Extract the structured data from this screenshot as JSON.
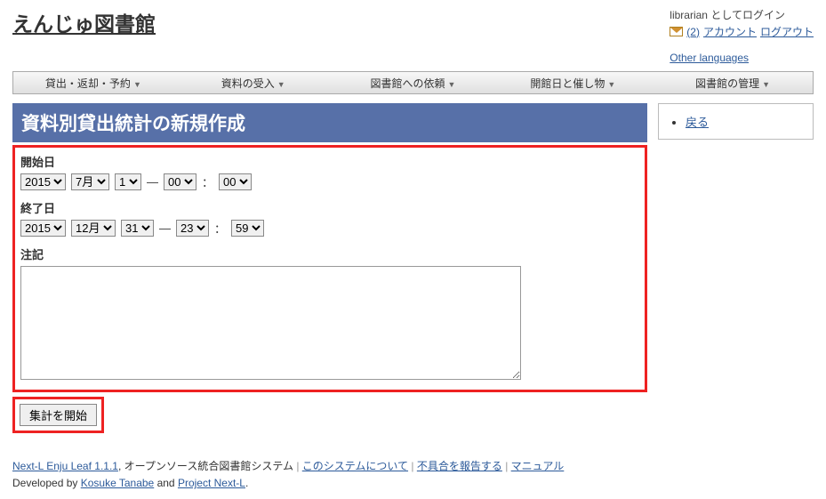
{
  "site_title": "えんじゅ図書館",
  "login_status": "librarian としてログイン",
  "login_links": {
    "count": "(2)",
    "account": "アカウント",
    "logout": "ログアウト"
  },
  "other_languages": "Other languages",
  "menu": {
    "loan": "貸出・返却・予約",
    "receive": "資料の受入",
    "request": "図書館への依頼",
    "holiday": "開館日と催し物",
    "admin": "図書館の管理"
  },
  "page_title": "資料別貸出統計の新規作成",
  "form": {
    "start_label": "開始日",
    "end_label": "終了日",
    "note_label": "注記",
    "dash": "—",
    "colon": "：",
    "start": {
      "year": "2015",
      "month": "7月",
      "day": "1",
      "hour": "00",
      "min": "00"
    },
    "end": {
      "year": "2015",
      "month": "12月",
      "day": "31",
      "hour": "23",
      "min": "59"
    },
    "note_value": "",
    "submit_label": "集計を開始"
  },
  "sidebar": {
    "back_label": "戻る"
  },
  "footer": {
    "product": "Next-L Enju Leaf 1.1.1",
    "tagline": ", オープンソース統合図書館システム",
    "about": "このシステムについて",
    "report": "不具合を報告する",
    "manual": "マニュアル",
    "developed_by": "Developed by ",
    "dev1": "Kosuke Tanabe",
    "and": " and ",
    "dev2": "Project Next-L",
    "period": "."
  }
}
